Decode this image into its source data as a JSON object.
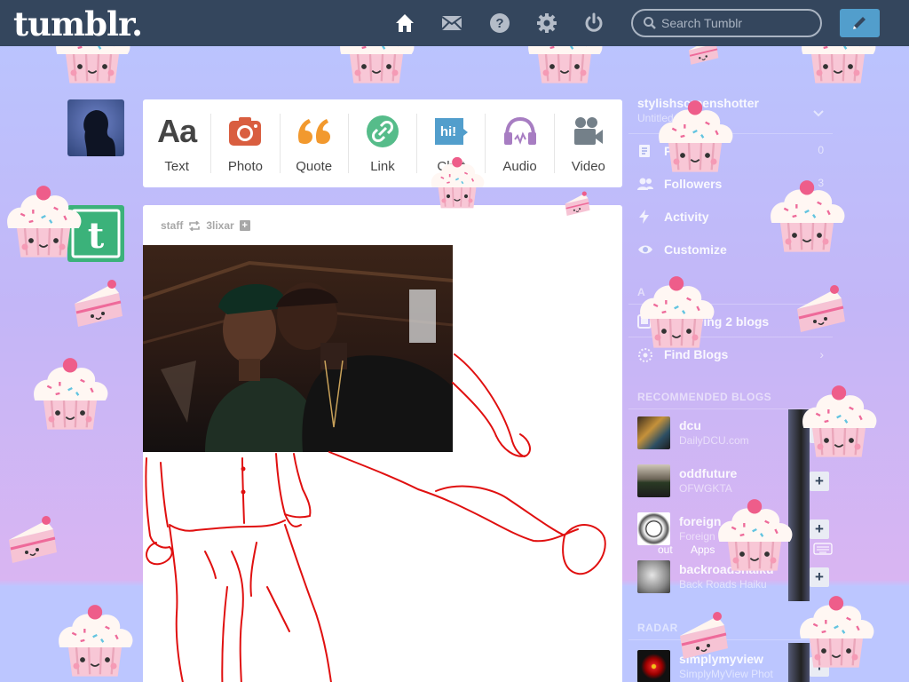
{
  "header": {
    "logo_text": "tumblr.",
    "nav_icons": [
      "home-icon",
      "mail-icon",
      "help-icon",
      "gear-icon",
      "power-icon"
    ],
    "search_placeholder": "Search Tumblr",
    "compose_icon": "pencil-icon",
    "bar_color": "#34465d",
    "compose_color": "#529ecc"
  },
  "post_types": [
    {
      "label": "Text",
      "icon": "text-icon",
      "glyph": "Aa",
      "color": "#444444"
    },
    {
      "label": "Photo",
      "icon": "camera-icon",
      "color": "#d95e40"
    },
    {
      "label": "Quote",
      "icon": "quote-icon",
      "color": "#f2992e"
    },
    {
      "label": "Link",
      "icon": "link-icon",
      "color": "#56bc8a"
    },
    {
      "label": "Chat",
      "icon": "chat-icon",
      "glyph": "hi!",
      "color": "#529ecc"
    },
    {
      "label": "Audio",
      "icon": "headphones-icon",
      "color": "#a77dc2"
    },
    {
      "label": "Video",
      "icon": "video-camera-icon",
      "color": "#748089"
    }
  ],
  "post": {
    "author": "staff",
    "reblogged_from": "3lixar"
  },
  "sidebar": {
    "blog_name": "stylishscreenshotter",
    "blog_title": "Untitled",
    "rows": [
      {
        "label": "Posts",
        "count": "0",
        "icon": "document-icon"
      },
      {
        "label": "Followers",
        "count": "3",
        "icon": "followers-icon"
      },
      {
        "label": "Activity",
        "count": "",
        "icon": "lightning-icon"
      },
      {
        "label": "Customize",
        "count": "",
        "icon": "eye-icon"
      }
    ],
    "account_section": "A",
    "account_rows": [
      {
        "label": "Following 2 blogs",
        "icon": "following-icon"
      },
      {
        "label": "Find Blogs",
        "icon": "compass-icon"
      }
    ],
    "recommended_title": "RECOMMENDED BLOGS",
    "recommended": [
      {
        "name": "dcu",
        "subtitle": "DailyDCU.com",
        "action": "+"
      },
      {
        "name": "oddfuture",
        "subtitle": "OFWGKTA",
        "action": "+"
      },
      {
        "name": "foreign",
        "subtitle": "Foreign",
        "action": "+"
      },
      {
        "name": "backroadshaiku",
        "subtitle": "Back Roads Haiku",
        "action": "+"
      }
    ],
    "footer_links": [
      "out",
      "Apps"
    ],
    "radar_title": "RADAR",
    "radar_blog": {
      "name": "simplymyview",
      "subtitle": "SimplyMyView Phot",
      "action": "+"
    }
  }
}
